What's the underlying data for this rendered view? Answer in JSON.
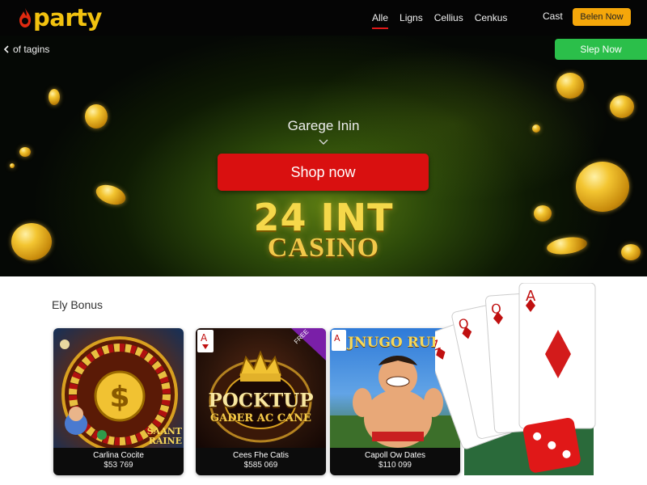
{
  "header": {
    "logo_text": "party",
    "nav": [
      "Alle",
      "Ligns",
      "Cellius",
      "Cenkus"
    ],
    "cart": "Cast",
    "cta": "Belen Now"
  },
  "subbar": {
    "back": "of tagins",
    "signup": "Slep Now"
  },
  "hero": {
    "kicker": "Garege Inin",
    "button": "Shop now",
    "title": "24 INT",
    "subtitle": "CASINO"
  },
  "bonus": {
    "title": "Ely Bonus",
    "cards": [
      {
        "name": "Carlina Cocite",
        "amount": "$53 769",
        "art_text": "SAANT RAINE"
      },
      {
        "name": "Cees Fhe Catis",
        "amount": "$585 069",
        "art_line1": "POCKTUP",
        "art_line2": "GADER AC CANE",
        "ribbon": "FREE"
      },
      {
        "name": "Capoll Ow Dates",
        "amount": "$110 099",
        "art_text": "JNUGO RUBE"
      }
    ]
  },
  "colors": {
    "accent_red": "#d91010",
    "accent_orange": "#f5a70a",
    "accent_green": "#2bbf4a",
    "brand_gold": "#f2c20f"
  }
}
